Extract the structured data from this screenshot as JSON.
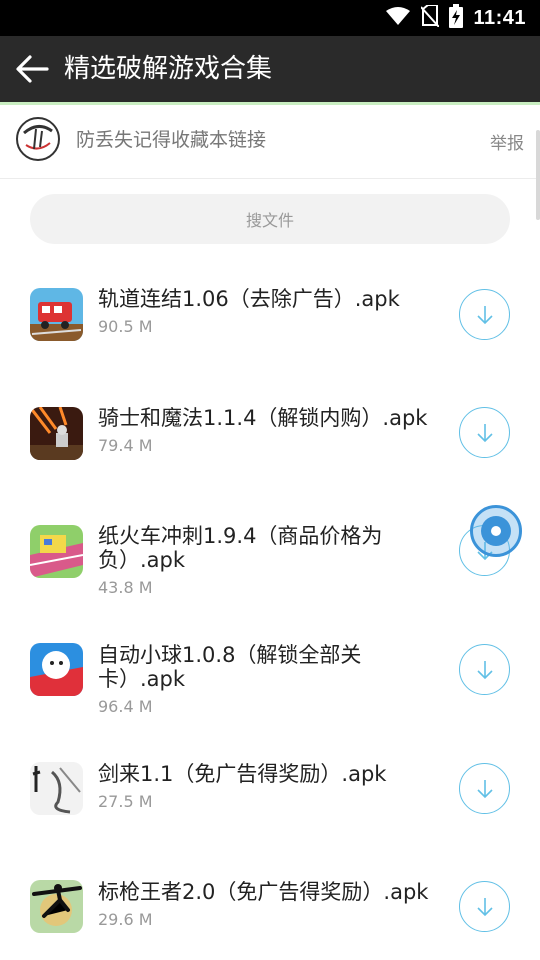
{
  "status_bar": {
    "time": "11:41",
    "icons": [
      "wifi-icon",
      "no-sim-icon",
      "battery-charging-icon"
    ]
  },
  "toolbar": {
    "title": "精选破解游戏合集",
    "back_icon": "back-arrow-icon"
  },
  "notice": {
    "text": "防丢失记得收藏本链接",
    "report_label": "举报"
  },
  "search": {
    "placeholder": "搜文件"
  },
  "files": [
    {
      "name": "轨道连结1.06（去除广告）.apk",
      "size": "90.5 M",
      "icon": "train-game-icon"
    },
    {
      "name": "骑士和魔法1.1.4（解锁内购）.apk",
      "size": "79.4 M",
      "icon": "knight-game-icon"
    },
    {
      "name": "纸火车冲刺1.9.4（商品价格为负）.apk",
      "size": "43.8 M",
      "icon": "paper-train-game-icon"
    },
    {
      "name": "自动小球1.0.8（解锁全部关卡）.apk",
      "size": "96.4 M",
      "icon": "ball-game-icon"
    },
    {
      "name": "剑来1.1（免广告得奖励）.apk",
      "size": "27.5 M",
      "icon": "sword-game-icon"
    },
    {
      "name": "标枪王者2.0（免广告得奖励）.apk",
      "size": "29.6 M",
      "icon": "javelin-game-icon"
    }
  ],
  "colors": {
    "toolbar_bg": "#2a2a2a",
    "accent_line": "#c9eec1",
    "download_ring": "#62c0e6",
    "float_button": "#3b93d9"
  }
}
